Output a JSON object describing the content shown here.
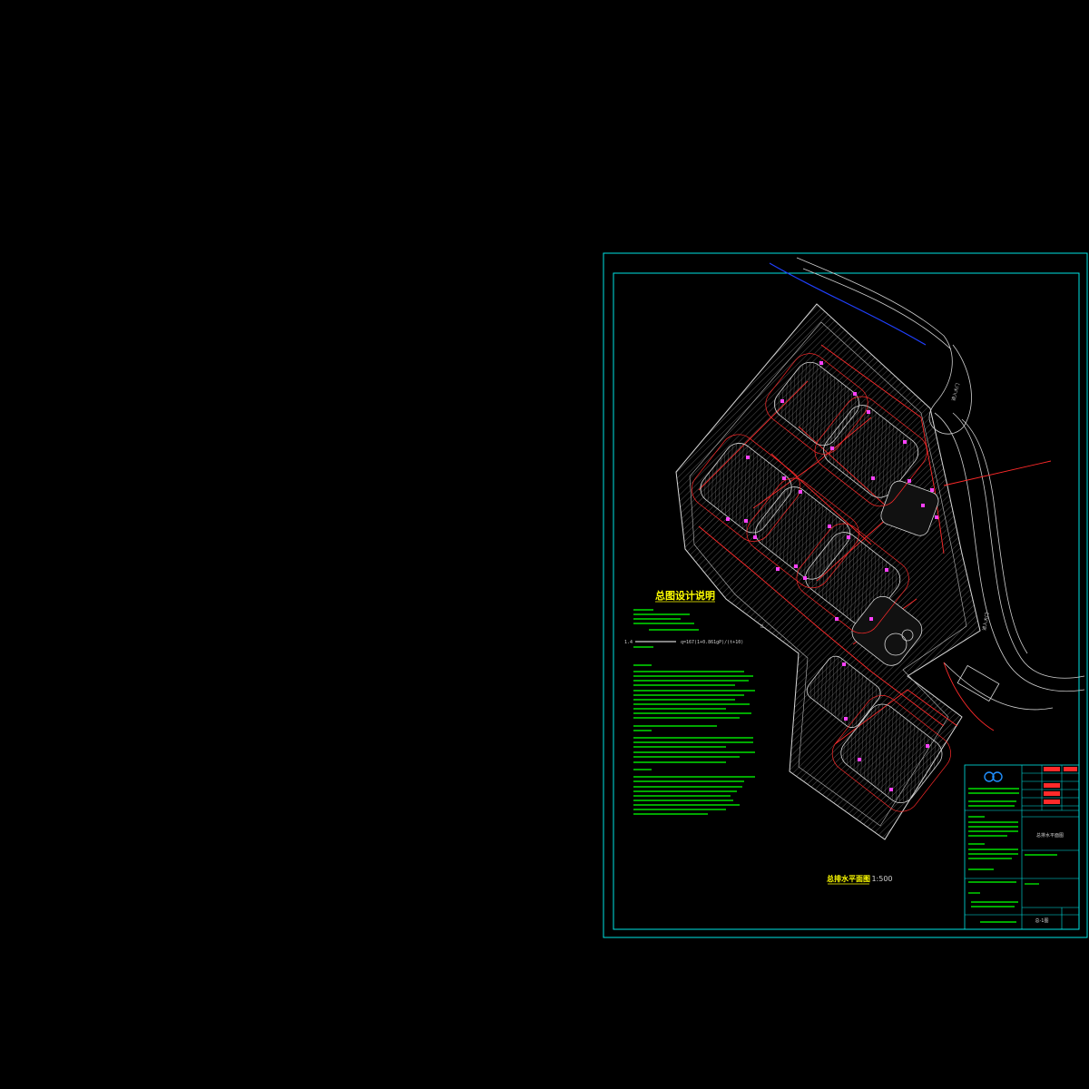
{
  "drawing": {
    "notes_title": "总图设计说明",
    "plan_title": "总排水平面图",
    "plan_scale": "1:500",
    "note_item_1_4": "1.4",
    "formula_text": "q=167(1+0.861gP)/(t+10)",
    "marker_b": "B",
    "road_label_1": "进入大门",
    "road_label_2": "进入大门"
  },
  "title_block": {
    "drawing_name": "总排水平面图",
    "sheet_code": "总-1图"
  },
  "colors": {
    "background": "#000000",
    "frame_cyan": "#00e5e5",
    "building_red": "#ff2a2a",
    "note_green": "#00e000",
    "note_yellow": "#ffff00",
    "marker_magenta": "#ff40ff",
    "road_white": "#d0d0d0",
    "river_blue": "#2040ff",
    "logo_blue": "#2090ff"
  }
}
